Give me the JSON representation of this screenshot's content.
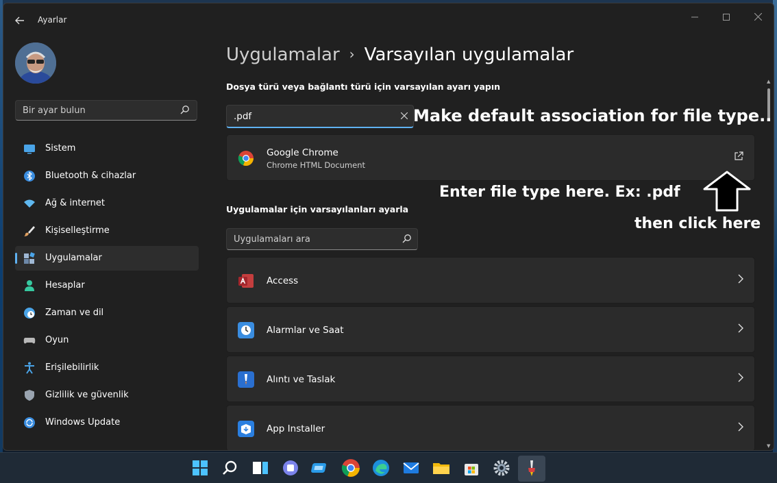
{
  "window": {
    "title": "Ayarlar"
  },
  "sidebar": {
    "search_placeholder": "Bir ayar bulun",
    "items": [
      {
        "label": "Sistem",
        "icon": "monitor-icon",
        "color": "#4aa4e8"
      },
      {
        "label": "Bluetooth & cihazlar",
        "icon": "bluetooth-icon",
        "color": "#3a8de0"
      },
      {
        "label": "Ağ & internet",
        "icon": "wifi-icon",
        "color": "#5fb8f0"
      },
      {
        "label": "Kişiselleştirme",
        "icon": "brush-icon",
        "color": "#e0a060"
      },
      {
        "label": "Uygulamalar",
        "icon": "apps-icon",
        "color": "#9fb8d4",
        "selected": true
      },
      {
        "label": "Hesaplar",
        "icon": "person-icon",
        "color": "#36c9a0"
      },
      {
        "label": "Zaman ve dil",
        "icon": "clock-globe-icon",
        "color": "#4aa4e8"
      },
      {
        "label": "Oyun",
        "icon": "gamepad-icon",
        "color": "#b8b8b8"
      },
      {
        "label": "Erişilebilirlik",
        "icon": "accessibility-icon",
        "color": "#4aa4e8"
      },
      {
        "label": "Gizlilik ve güvenlik",
        "icon": "shield-icon",
        "color": "#9aa4b0"
      },
      {
        "label": "Windows Update",
        "icon": "update-icon",
        "color": "#3a8de0"
      }
    ]
  },
  "main": {
    "breadcrumb": {
      "parent": "Uygulamalar",
      "separator": "›",
      "current": "Varsayılan uygulamalar"
    },
    "filetype_section": {
      "title": "Dosya türü veya bağlantı türü için varsayılan ayarı yapın",
      "input_value": ".pdf",
      "result": {
        "name": "Google Chrome",
        "subtitle": "Chrome HTML Document",
        "icon": "chrome-icon"
      }
    },
    "apps_section": {
      "title": "Uygulamalar için varsayılanları ayarla",
      "search_placeholder": "Uygulamaları ara",
      "apps": [
        {
          "name": "Access",
          "icon": "access-icon",
          "color": "#b7302f"
        },
        {
          "name": "Alarmlar ve Saat",
          "icon": "alarm-clock-icon",
          "color": "#3a8de0"
        },
        {
          "name": "Alıntı ve Taslak",
          "icon": "snip-sketch-icon",
          "color": "#2a6fd0"
        },
        {
          "name": "App Installer",
          "icon": "app-installer-icon",
          "color": "#2a7fe0"
        }
      ]
    }
  },
  "annotations": {
    "heading": "Make default association for file type..",
    "instruction": "Enter file type here. Ex: .pdf",
    "click_hint": "then click here"
  },
  "taskbar": {
    "icons": [
      "start-icon",
      "search-icon",
      "task-view-icon",
      "teams-icon",
      "widgets-icon",
      "chrome-icon",
      "edge-icon",
      "mail-icon",
      "file-explorer-icon",
      "store-icon",
      "settings-icon",
      "paint-icon"
    ]
  }
}
